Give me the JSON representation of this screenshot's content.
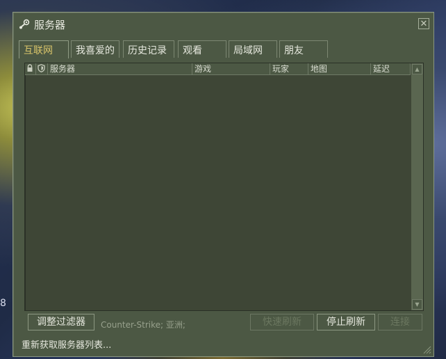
{
  "desktop": {
    "edge_text": "8"
  },
  "window": {
    "title": "服务器",
    "close_glyph": "✕"
  },
  "tabs": [
    {
      "label": "互联网",
      "active": true
    },
    {
      "label": "我喜爱的",
      "active": false
    },
    {
      "label": "历史记录",
      "active": false
    },
    {
      "label": "观看",
      "active": false
    },
    {
      "label": "局域网",
      "active": false
    },
    {
      "label": "朋友",
      "active": false
    }
  ],
  "columns": {
    "lock_icon": "lock-icon",
    "shield_icon": "shield-icon",
    "server": "服务器",
    "game": "游戏",
    "players": "玩家",
    "map": "地图",
    "latency": "延迟"
  },
  "footer": {
    "filter_button": "调整过滤器",
    "filter_summary": "Counter-Strike; 亚洲;",
    "quick_refresh": "快速刷新",
    "stop_refresh": "停止刷新",
    "connect": "连接"
  },
  "status_text": "重新获取服务器列表...",
  "colors": {
    "window_bg": "#4c5844",
    "list_bg": "#3e4636",
    "active_tab": "#d8c46a",
    "text": "#e6e8de"
  }
}
